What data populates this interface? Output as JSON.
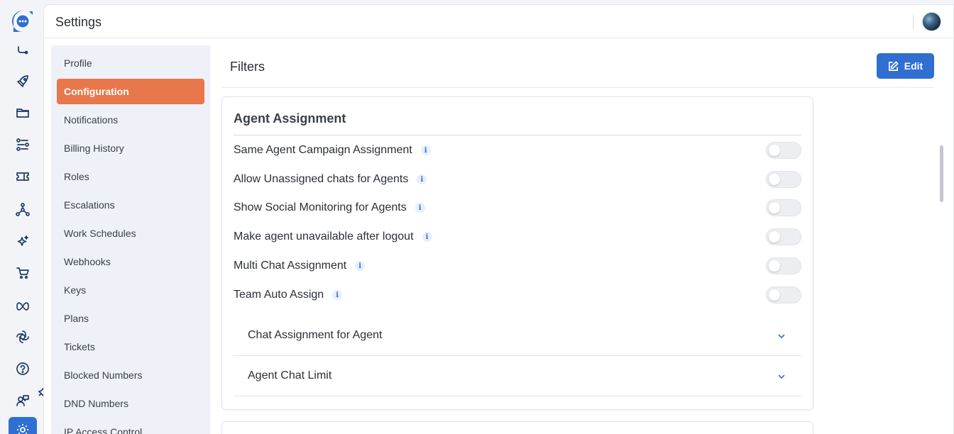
{
  "header": {
    "title": "Settings"
  },
  "settings_nav": {
    "items": [
      {
        "label": "Profile",
        "selected": false
      },
      {
        "label": "Configuration",
        "selected": true
      },
      {
        "label": "Notifications",
        "selected": false
      },
      {
        "label": "Billing History",
        "selected": false
      },
      {
        "label": "Roles",
        "selected": false
      },
      {
        "label": "Escalations",
        "selected": false
      },
      {
        "label": "Work Schedules",
        "selected": false
      },
      {
        "label": "Webhooks",
        "selected": false
      },
      {
        "label": "Keys",
        "selected": false
      },
      {
        "label": "Plans",
        "selected": false
      },
      {
        "label": "Tickets",
        "selected": false
      },
      {
        "label": "Blocked Numbers",
        "selected": false
      },
      {
        "label": "DND Numbers",
        "selected": false
      },
      {
        "label": "IP Access Control",
        "selected": false
      }
    ]
  },
  "rail": {
    "icons": [
      "chat-logo-icon",
      "routing-icon",
      "rocket-icon",
      "folder-icon",
      "workflow-icon",
      "ticket-icon",
      "network-icon",
      "sparkle-icon",
      "cart-icon",
      "meta-icon",
      "openai-icon",
      "help-icon",
      "agent-support-icon",
      "settings-icon"
    ],
    "active": "settings-icon"
  },
  "main": {
    "section_title": "Filters",
    "edit_label": "Edit",
    "card": {
      "title": "Agent Assignment",
      "toggles": [
        {
          "label": "Same Agent Campaign Assignment",
          "enabled": false
        },
        {
          "label": "Allow Unassigned chats for Agents",
          "enabled": false
        },
        {
          "label": "Show Social Monitoring for Agents",
          "enabled": false
        },
        {
          "label": "Make agent unavailable after logout",
          "enabled": false
        },
        {
          "label": "Multi Chat Assignment",
          "enabled": false
        },
        {
          "label": "Team Auto Assign",
          "enabled": false
        }
      ],
      "info_glyph": "i",
      "accordions": [
        {
          "label": "Chat Assignment for Agent",
          "expanded": false
        },
        {
          "label": "Agent Chat Limit",
          "expanded": false
        }
      ]
    }
  },
  "colors": {
    "accent": "#2f6fd1",
    "selected_nav": "#e8774c"
  }
}
